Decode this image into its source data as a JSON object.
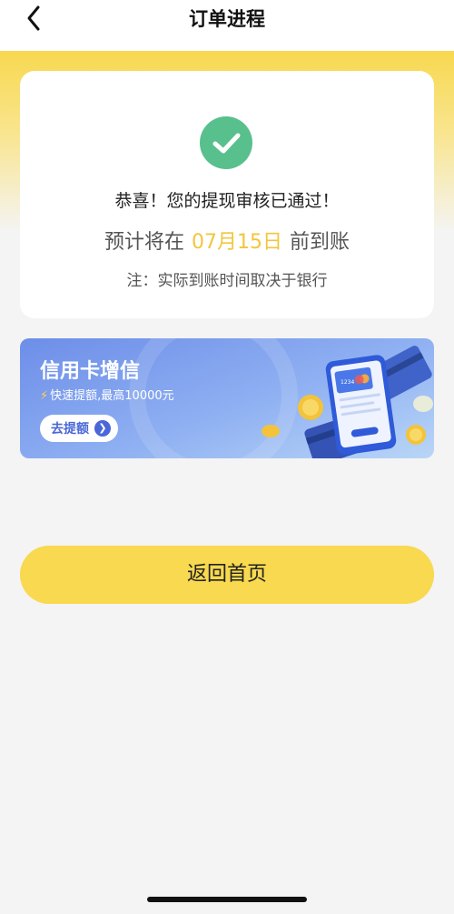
{
  "navbar": {
    "title": "订单进程",
    "back_icon": "chevron-left-icon"
  },
  "status": {
    "icon": "check-circle-icon",
    "icon_color": "#58c08c",
    "message": "恭喜！您的提现审核已通过！",
    "eta_prefix": "预计将在",
    "eta_date": "07月15日",
    "eta_suffix": "前到账",
    "note": "注：实际到账时间取决于银行"
  },
  "banner": {
    "title": "信用卡增信",
    "subtitle": "快速提额,最高10000元",
    "button_label": "去提额",
    "card_text": "1234",
    "illustration": "phone-credit-card-coins-illustration"
  },
  "actions": {
    "home_label": "返回首页"
  },
  "colors": {
    "accent_yellow": "#f8d94f",
    "date_highlight": "#f2c63c",
    "banner_blue": "#6d8ee8",
    "success_green": "#58c08c"
  }
}
